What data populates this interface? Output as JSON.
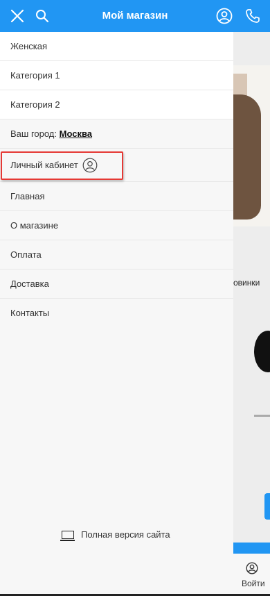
{
  "header": {
    "title": "Мой магазин",
    "close_icon": "close-icon",
    "search_icon": "search-icon",
    "user_icon": "user-circle-icon",
    "phone_icon": "phone-icon"
  },
  "menu": {
    "items_top": [
      "Женская",
      "Категория 1",
      "Категория 2"
    ],
    "city_label": "Ваш город:",
    "city_value": "Москва",
    "cabinet_label": "Личный кабинет",
    "items_bottom": [
      "Главная",
      "О магазине",
      "Оплата",
      "Доставка",
      "Контакты"
    ],
    "full_version": "Полная версия сайта"
  },
  "background_page": {
    "section_label": "овинки",
    "login_label": "Войти"
  },
  "colors": {
    "accent": "#2196f3",
    "highlight": "#e53935"
  }
}
